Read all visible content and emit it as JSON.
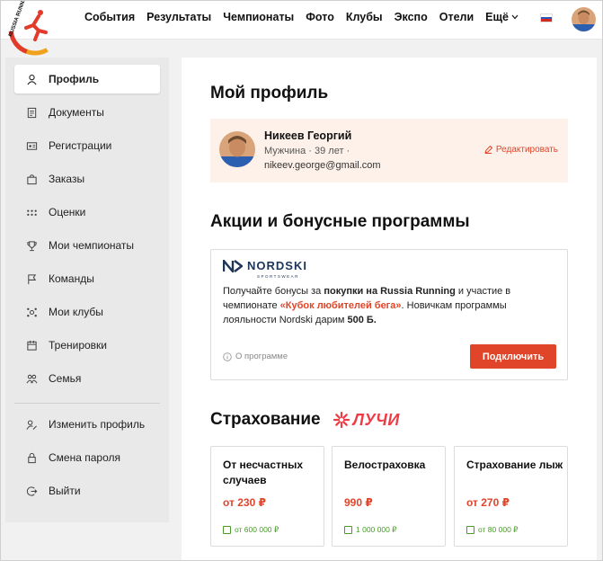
{
  "brand": {
    "logo_text": "RUSSIA RUNNING"
  },
  "nav": {
    "items": [
      "События",
      "Результаты",
      "Чемпионаты",
      "Фото",
      "Клубы",
      "Экспо",
      "Отели"
    ],
    "more_label": "Ещё"
  },
  "sidebar": {
    "items": [
      {
        "label": "Профиль",
        "icon": "user-icon"
      },
      {
        "label": "Документы",
        "icon": "document-icon"
      },
      {
        "label": "Регистрации",
        "icon": "id-card-icon"
      },
      {
        "label": "Заказы",
        "icon": "bag-icon"
      },
      {
        "label": "Оценки",
        "icon": "dots-icon"
      },
      {
        "label": "Мои чемпионаты",
        "icon": "trophy-icon"
      },
      {
        "label": "Команды",
        "icon": "flag-icon"
      },
      {
        "label": "Мои клубы",
        "icon": "club-icon"
      },
      {
        "label": "Тренировки",
        "icon": "training-icon"
      },
      {
        "label": "Семья",
        "icon": "family-icon"
      }
    ],
    "account_items": [
      {
        "label": "Изменить профиль",
        "icon": "edit-profile-icon"
      },
      {
        "label": "Смена пароля",
        "icon": "lock-icon"
      },
      {
        "label": "Выйти",
        "icon": "logout-icon"
      }
    ]
  },
  "profile": {
    "heading": "Мой профиль",
    "name": "Никеев Георгий",
    "meta": "Мужчина · 39 лет ·",
    "email": "nikeev.george@gmail.com",
    "edit_label": "Редактировать"
  },
  "promo": {
    "heading": "Акции и бонусные программы",
    "brand_word": "NORDSKI",
    "brand_sub": "SPORTSWEAR",
    "text_1": "Получайте бонусы за ",
    "text_b1": "покупки на Russia Running",
    "text_2": " и участие в чемпионате ",
    "text_red": "«Кубок любителей бега»",
    "text_3": ". Новичкам программы лояльности Nordski дарим ",
    "text_b2": "500 Б.",
    "about_label": "О программе",
    "connect_label": "Подключить"
  },
  "insurance": {
    "heading": "Страхование",
    "partner": "ЛУЧИ",
    "cards": [
      {
        "title": "От несчастных случаев",
        "price": "от 230 ₽",
        "coverage": "от 600 000 ₽"
      },
      {
        "title": "Велостраховка",
        "price": "990 ₽",
        "coverage": "1 000 000 ₽"
      },
      {
        "title": "Страхование лыж",
        "price": "от 270 ₽",
        "coverage": "от 80 000 ₽"
      }
    ]
  },
  "colors": {
    "accent": "#e0452a",
    "coverage": "#4a9a2a",
    "luchi": "#ef3b46",
    "promo_bg": "#fdf1ea"
  }
}
